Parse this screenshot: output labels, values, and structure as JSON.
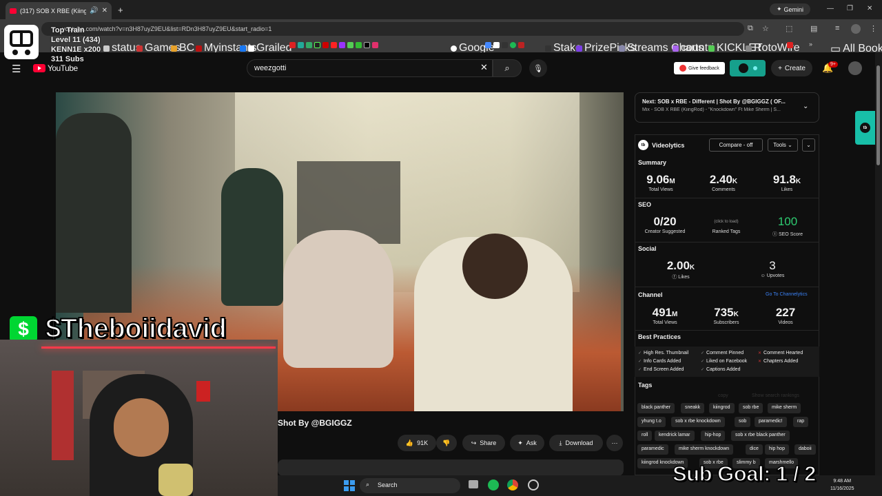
{
  "browser": {
    "tab_title": "(317) SOB X RBE (KiingRod)",
    "gemini_label": "Gemini",
    "url": "youtube.com/watch?v=n3H87uyZ9EU&list=RDn3H87uyZ9EU&start_radio=1",
    "bookmarks": [
      "status",
      "Games",
      "BC",
      "Myinstants",
      "Grailed",
      "Google",
      "Stake",
      "PrizePicks",
      "Streams Charts",
      "countri",
      "KICKLET",
      "RotoWire",
      "All Bookmarks"
    ]
  },
  "youtube": {
    "logo_text": "YouTube",
    "search_value": "weezgotti",
    "feedback_label": "Give feedback",
    "create_label": "Create",
    "notif_badge": "9+"
  },
  "video": {
    "title_visible": "Shot By @BGIGGZ",
    "likes": "91K",
    "share_label": "Share",
    "ask_label": "Ask",
    "download_label": "Download"
  },
  "next": {
    "title": "Next: SOB x RBE - Different | Shot By @BGIGGZ ( OF...",
    "subtitle": "Mix - SOB X RBE (KiingRod) - \"Knockdown\" Ft Mike Sherm | S..."
  },
  "videolytics": {
    "title": "Videolytics",
    "compare_label": "Compare - off",
    "tools_label": "Tools",
    "summary_head": "Summary",
    "summary": [
      {
        "num": "9.06",
        "unit": "M",
        "label": "Total Views"
      },
      {
        "num": "2.40",
        "unit": "K",
        "label": "Comments"
      },
      {
        "num": "91.8",
        "unit": "K",
        "label": "Likes"
      }
    ],
    "seo_head": "SEO",
    "seo_creator_num": "0/20",
    "seo_creator_label": "Creator Suggested",
    "seo_click": "(click to load)",
    "seo_ranked_label": "Ranked Tags",
    "seo_score": "100",
    "seo_score_label": "SEO Score",
    "social_head": "Social",
    "social_likes_num": "2.00",
    "social_likes_unit": "K",
    "social_likes_label": "Likes",
    "social_upvotes_num": "3",
    "social_upvotes_label": "Upvotes",
    "channel_head": "Channel",
    "channel_link": "Go To Channelytics",
    "channel": [
      {
        "num": "491",
        "unit": "M",
        "label": "Total Views"
      },
      {
        "num": "735",
        "unit": "K",
        "label": "Subscribers"
      },
      {
        "num": "227",
        "unit": "",
        "label": "Videos"
      }
    ],
    "bp_head": "Best Practices",
    "best_practices": [
      "High Res. Thumbnail",
      "Comment Pinned",
      "Comment Hearted",
      "Info Cards Added",
      "Liked on Facebook",
      "Chapters Added",
      "End Screen Added",
      "Captions Added"
    ],
    "tags_head": "Tags",
    "tags_copy": "copy",
    "tags_search": "Show search rankings",
    "tags": [
      "black panther",
      "sneakk",
      "kiingrod",
      "sob rbe",
      "mike sherm",
      "yhung t.o",
      "sob x rbe knockdown",
      "sob",
      "paramedic!",
      "rap",
      "roll",
      "kendrick lamar",
      "hip-hop",
      "sob x rbe black panther",
      "paramedic",
      "mike sherm knockdown",
      "dice",
      "hip hop",
      "daboii",
      "kiingrod knockdown",
      "sob x rbe",
      "slimmy b",
      "marshmello"
    ]
  },
  "overlay": {
    "train_title": "Top Train",
    "train_level": "Level 11  (434)",
    "train_user": "KENN1E x200",
    "train_subs": "311 Subs",
    "cashtag": "$Theboiidavid",
    "sub_goal": "Sub Goal:  1 / 2"
  },
  "taskbar": {
    "search_label": "Search",
    "time": "9:48 AM",
    "date": "11/16/2025"
  }
}
